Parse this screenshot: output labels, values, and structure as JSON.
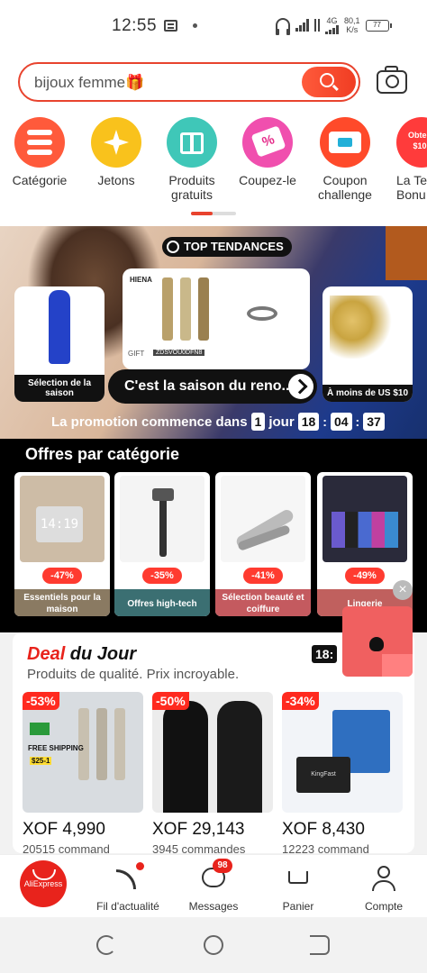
{
  "status_bar": {
    "time": "12:55",
    "net_type": "4G",
    "speed_value": "80,1",
    "speed_unit": "K/s",
    "battery": "77"
  },
  "search": {
    "query": "bijoux femme🎁"
  },
  "quick_links": [
    {
      "label": "Catégorie",
      "color": "#ff5a3b",
      "icon": "category-icon"
    },
    {
      "label": "Jetons",
      "color": "#f9c21c",
      "icon": "coin-icon"
    },
    {
      "label": "Produits gratuits",
      "color": "#3fc7b8",
      "icon": "gift-icon"
    },
    {
      "label": "Coupez-le",
      "color": "#f04fae",
      "icon": "discount-tag-icon"
    },
    {
      "label": "Coupon challenge",
      "color": "#ff4a2a",
      "icon": "coupon-icon"
    },
    {
      "label": "La Te Bonu",
      "color": "#ff3b3b",
      "icon": "bonus-icon",
      "badge": "Obten $10"
    }
  ],
  "banner": {
    "badge": "TOP TENDANCES",
    "left_card": "Sélection de la saison",
    "center_card": "C'est la saison du reno...",
    "center_gift": "GIFT",
    "center_code": "ZDSVOU0DFN8",
    "center_brand": "HIENA",
    "right_card": "À moins de US $10",
    "countdown_text": "La promotion commence dans",
    "days": "1",
    "days_label": "jour",
    "hours": "18",
    "minutes": "04",
    "seconds": "37"
  },
  "offers": {
    "title": "Offres par catégorie",
    "cards": [
      {
        "discount": "-47%",
        "caption": "Essentiels pour la maison",
        "cap_color": "#8a7a62",
        "img_color": "#c9b9a4",
        "screen": "14:19"
      },
      {
        "discount": "-35%",
        "caption": "Offres high-tech",
        "cap_color": "#3b6f72",
        "img_color": "#f4f4f4"
      },
      {
        "discount": "-41%",
        "caption": "Sélection beauté et coiffure",
        "cap_color": "#c45a5f",
        "img_color": "#f6f6f6"
      },
      {
        "discount": "-49%",
        "caption": "Lingerie",
        "cap_color": "#c0605e",
        "img_color": "#2a2a3a"
      }
    ]
  },
  "deal": {
    "title_red": "Deal",
    "title_black": " du Jour",
    "subtitle": "Produits de qualité. Prix incroyable.",
    "timer": "18:",
    "items": [
      {
        "discount": "-53%",
        "price": "XOF 4,990",
        "orders": "20515 command",
        "img_color": "#d8dce0",
        "overlay": "FREE SHIPPING",
        "overlay2": "$25-1"
      },
      {
        "discount": "-50%",
        "price": "XOF 29,143",
        "orders": "3945 commandes",
        "img_color": "#ececec"
      },
      {
        "discount": "-34%",
        "price": "XOF 8,430",
        "orders": "12223 command",
        "img_color": "#f2f4f8",
        "brand": "KingFast"
      }
    ]
  },
  "bottom_nav": [
    {
      "label": "AliExpress",
      "icon": "aliexpress-logo-icon"
    },
    {
      "label": "Fil d'actualité",
      "icon": "feed-icon"
    },
    {
      "label": "Messages",
      "icon": "messages-icon",
      "badge": "98"
    },
    {
      "label": "Panier",
      "icon": "cart-icon"
    },
    {
      "label": "Compte",
      "icon": "account-icon"
    }
  ]
}
